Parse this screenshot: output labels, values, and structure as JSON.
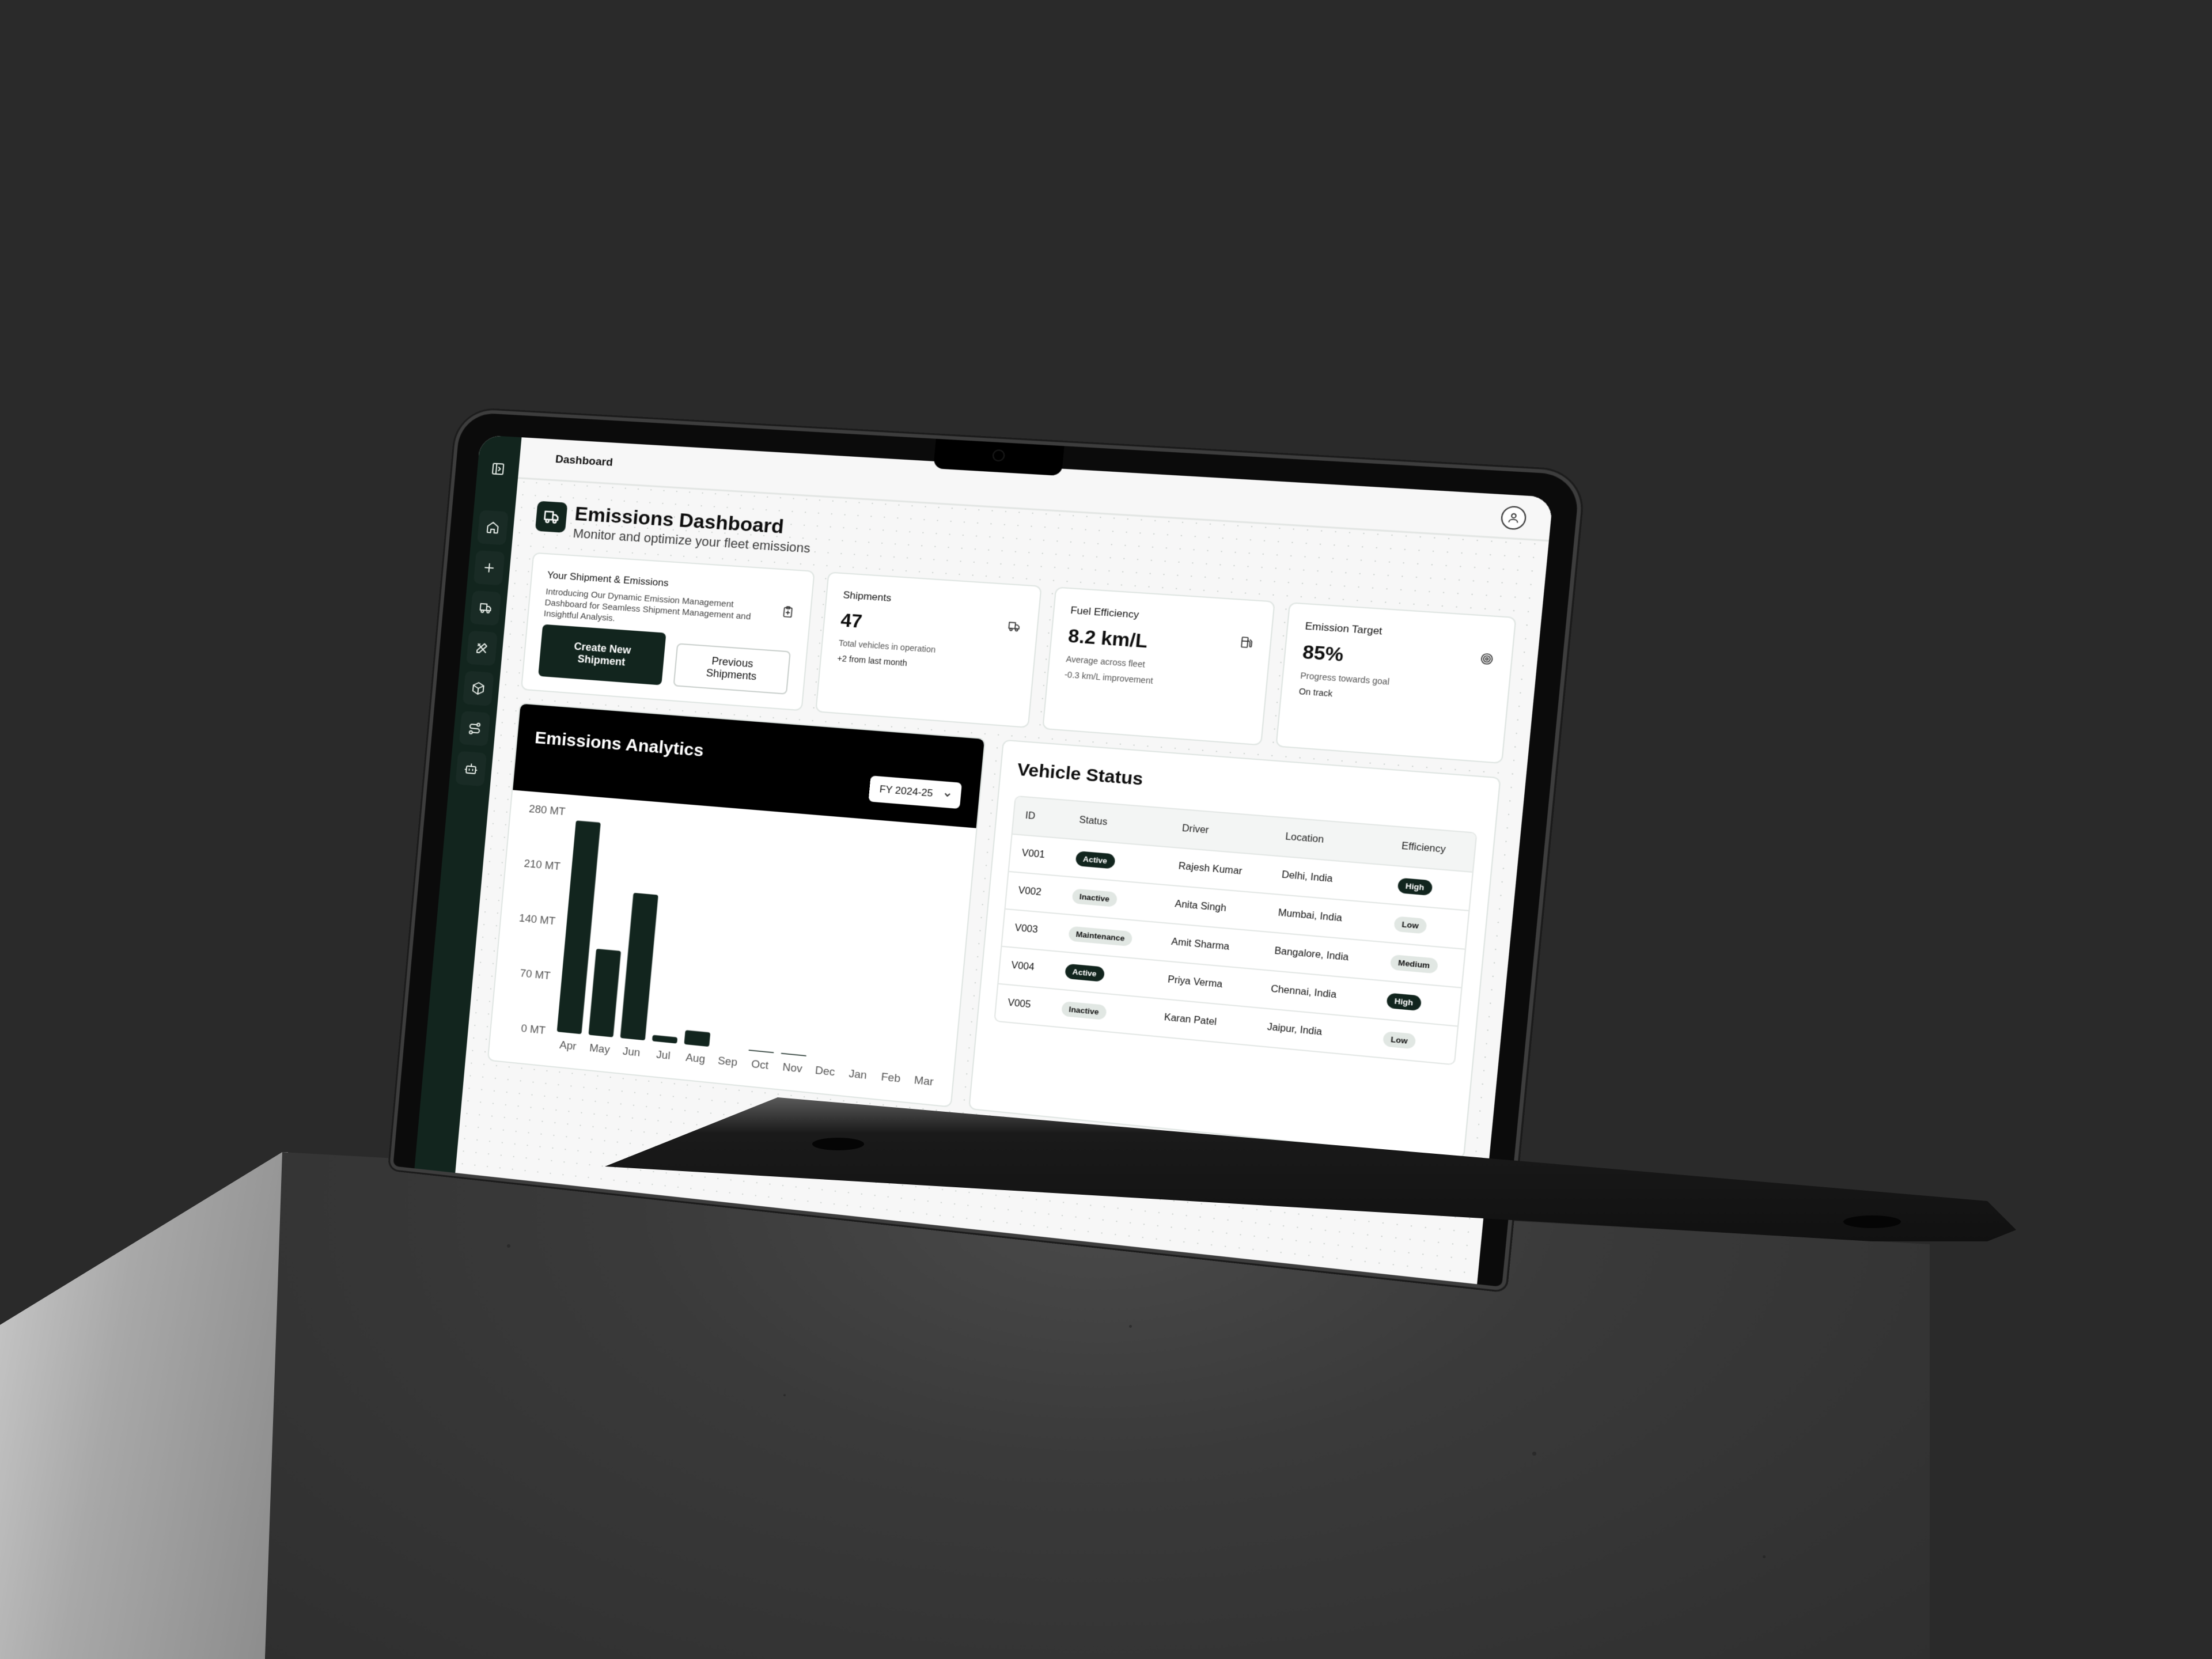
{
  "colors": {
    "accent": "#12251e",
    "background": "#2a2a2a",
    "badge_light": "#e1e7e3"
  },
  "header": {
    "breadcrumb": "Dashboard",
    "avatar_icon": "user-icon"
  },
  "sidebar": {
    "toggle_icon": "panel-left-icon",
    "items": [
      {
        "name": "home",
        "icon": "home-icon"
      },
      {
        "name": "add",
        "icon": "plus-icon"
      },
      {
        "name": "shipments",
        "icon": "truck-icon"
      },
      {
        "name": "tools",
        "icon": "pencil-ruler-icon"
      },
      {
        "name": "packages",
        "icon": "package-icon"
      },
      {
        "name": "routes",
        "icon": "route-icon"
      },
      {
        "name": "assistant",
        "icon": "bot-icon"
      }
    ]
  },
  "page": {
    "icon": "truck-icon",
    "title": "Emissions Dashboard",
    "subtitle": "Monitor and optimize your fleet emissions"
  },
  "welcome": {
    "title": "Your Shipment & Emissions",
    "description": "Introducing Our Dynamic Emission Management Dashboard for Seamless Shipment Management and Insightful Analysis.",
    "icon": "clipboard-plus-icon",
    "primary_button": "Create New Shipment",
    "secondary_button": "Previous Shipments"
  },
  "stats": [
    {
      "title": "Shipments",
      "value": "47",
      "subtitle": "Total vehicles in operation",
      "note": "+2 from last month",
      "icon": "truck-icon"
    },
    {
      "title": "Fuel Efficiency",
      "value": "8.2 km/L",
      "subtitle": "Average across fleet",
      "note": "-0.3 km/L improvement",
      "icon": "fuel-icon"
    },
    {
      "title": "Emission Target",
      "value": "85%",
      "subtitle": "Progress towards goal",
      "note": "On track",
      "icon": "target-icon"
    }
  ],
  "analytics": {
    "title": "Emissions Analytics",
    "period_select": "FY 2024-25"
  },
  "chart_data": {
    "type": "bar",
    "title": "Emissions Analytics",
    "categories": [
      "Apr",
      "May",
      "Jun",
      "Jul",
      "Aug",
      "Sep",
      "Oct",
      "Nov",
      "Dec",
      "Jan",
      "Feb",
      "Mar"
    ],
    "values": [
      270,
      110,
      185,
      8,
      18,
      0,
      1,
      1,
      0,
      0,
      0,
      0
    ],
    "yticks": [
      "0 MT",
      "70 MT",
      "140 MT",
      "210 MT",
      "280 MT"
    ],
    "ylim": [
      0,
      280
    ],
    "ylabel": "",
    "xlabel": "",
    "unit": "MT",
    "grid": false
  },
  "vehicles": {
    "title": "Vehicle Status",
    "columns": [
      "ID",
      "Status",
      "Driver",
      "Location",
      "Efficiency"
    ],
    "rows": [
      {
        "id": "V001",
        "status": "Active",
        "driver": "Rajesh Kumar",
        "location": "Delhi, India",
        "efficiency": "High"
      },
      {
        "id": "V002",
        "status": "Inactive",
        "driver": "Anita Singh",
        "location": "Mumbai, India",
        "efficiency": "Low"
      },
      {
        "id": "V003",
        "status": "Maintenance",
        "driver": "Amit Sharma",
        "location": "Bangalore, India",
        "efficiency": "Medium"
      },
      {
        "id": "V004",
        "status": "Active",
        "driver": "Priya Verma",
        "location": "Chennai, India",
        "efficiency": "High"
      },
      {
        "id": "V005",
        "status": "Inactive",
        "driver": "Karan Patel",
        "location": "Jaipur, India",
        "efficiency": "Low"
      }
    ]
  }
}
